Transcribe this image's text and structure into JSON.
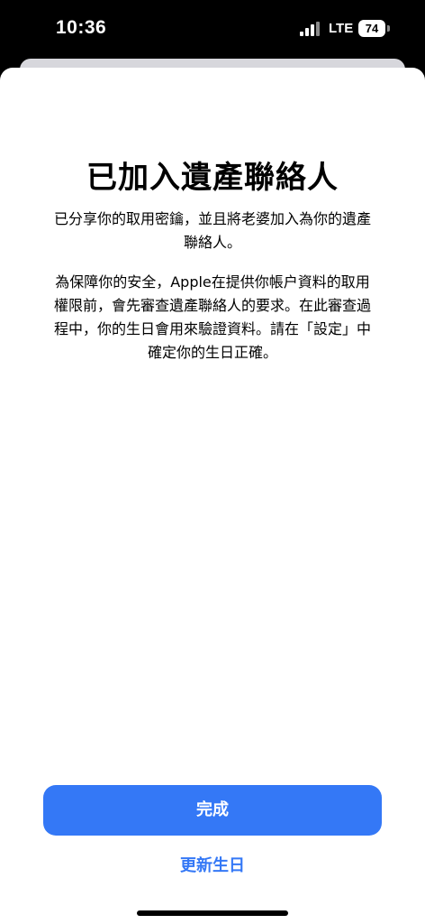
{
  "status_bar": {
    "time": "10:36",
    "network": "LTE",
    "battery_level": "74",
    "signal_icon": "cellular-signal-icon",
    "battery_icon": "battery-icon"
  },
  "sheet": {
    "title": "已加入遺產聯絡人",
    "message_1": "已分享你的取用密鑰，並且將老婆加入為你的遺產聯絡人。",
    "message_2": "為保障你的安全，Apple在提供你帳户資料的取用權限前，會先審查遺產聯絡人的要求。在此審查過程中，你的生日會用來驗證資料。請在「設定」中確定你的生日正確。"
  },
  "actions": {
    "done_label": "完成",
    "update_birthday_label": "更新生日"
  },
  "colors": {
    "accent": "#3478f6",
    "background": "#ffffff",
    "status_bar_bg": "#000000"
  }
}
